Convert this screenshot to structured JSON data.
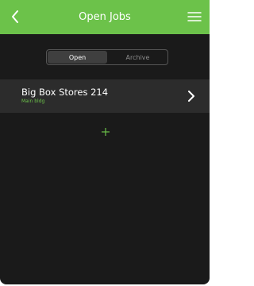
{
  "header": {
    "title": "Open Jobs",
    "back_icon": "chevron-left-icon",
    "menu_icon": "hamburger-menu-icon",
    "background_color": "#6cc24a"
  },
  "segments": {
    "items": [
      {
        "label": "Open",
        "selected": true
      },
      {
        "label": "Archive",
        "selected": false
      }
    ]
  },
  "jobs": [
    {
      "title": "Big Box Stores 214",
      "subtitle": "Main bldg",
      "chevron_icon": "chevron-right-icon"
    }
  ],
  "add": {
    "icon": "plus-icon",
    "color": "#6cc24a"
  },
  "colors": {
    "accent": "#6cc24a",
    "background": "#1a1a1a",
    "row_background": "#2c2c2c"
  }
}
